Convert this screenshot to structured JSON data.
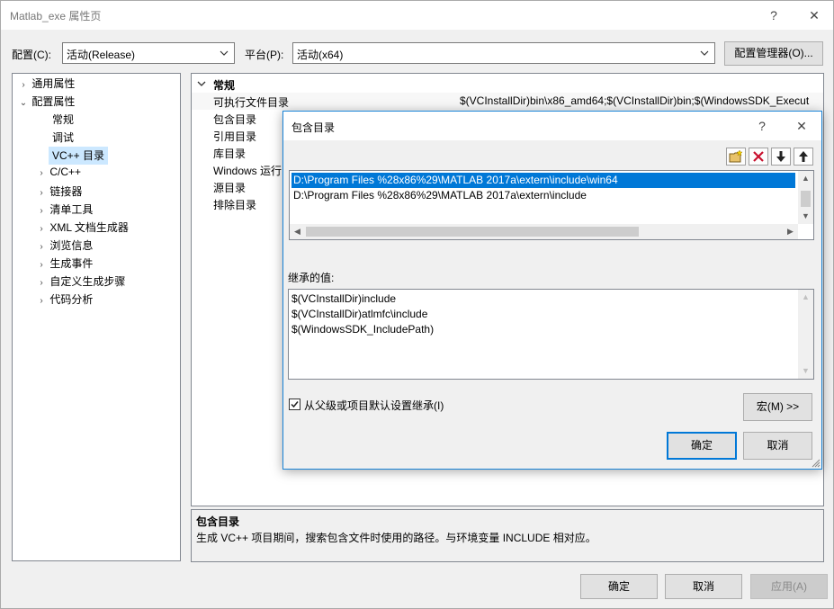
{
  "window": {
    "title": "Matlab_exe 属性页",
    "help": "?",
    "close": "✕"
  },
  "config": {
    "config_label": "配置(C):",
    "config_value": "活动(Release)",
    "platform_label": "平台(P):",
    "platform_value": "活动(x64)",
    "manager_button": "配置管理器(O)..."
  },
  "tree": {
    "items": [
      {
        "label": "通用属性",
        "chevron": "›"
      },
      {
        "label": "配置属性",
        "chevron": "⌄"
      },
      {
        "label": "常规",
        "chevron": ""
      },
      {
        "label": "调试",
        "chevron": ""
      },
      {
        "label": "VC++ 目录",
        "chevron": ""
      },
      {
        "label": "C/C++",
        "chevron": "›"
      },
      {
        "label": "链接器",
        "chevron": "›"
      },
      {
        "label": "清单工具",
        "chevron": "›"
      },
      {
        "label": "XML 文档生成器",
        "chevron": "›"
      },
      {
        "label": "浏览信息",
        "chevron": "›"
      },
      {
        "label": "生成事件",
        "chevron": "›"
      },
      {
        "label": "自定义生成步骤",
        "chevron": "›"
      },
      {
        "label": "代码分析",
        "chevron": "›"
      }
    ]
  },
  "grid": {
    "section": "常规",
    "rows": [
      {
        "name": "可执行文件目录",
        "value": "$(VCInstallDir)bin\\x86_amd64;$(VCInstallDir)bin;$(WindowsSDK_Execut"
      },
      {
        "name": "包含目录",
        "value": ""
      },
      {
        "name": "引用目录",
        "value": ""
      },
      {
        "name": "库目录",
        "value": ""
      },
      {
        "name": "Windows 运行",
        "value": ""
      },
      {
        "name": "源目录",
        "value": ""
      },
      {
        "name": "排除目录",
        "value": ""
      }
    ]
  },
  "description": {
    "title": "包含目录",
    "text": "生成 VC++ 项目期间，搜索包含文件时使用的路径。与环境变量 INCLUDE 相对应。"
  },
  "bottom_buttons": {
    "ok": "确定",
    "cancel": "取消",
    "apply": "应用(A)"
  },
  "dialog": {
    "title": "包含目录",
    "help": "?",
    "close": "✕",
    "entries": [
      "D:\\Program Files %28x86%29\\MATLAB 2017a\\extern\\include\\win64",
      "D:\\Program Files %28x86%29\\MATLAB 2017a\\extern\\include"
    ],
    "inherited_label": "继承的值:",
    "inherited": [
      "$(VCInstallDir)include",
      "$(VCInstallDir)atlmfc\\include",
      "$(WindowsSDK_IncludePath)"
    ],
    "inherit_checkbox": "从父级或项目默认设置继承(I)",
    "inherit_checked": true,
    "macro_button": "宏(M) >>",
    "ok": "确定",
    "cancel": "取消"
  },
  "colors": {
    "selection": "#0078d7",
    "accent_border": "#1883d7",
    "tree_selected": "#cce8ff"
  }
}
